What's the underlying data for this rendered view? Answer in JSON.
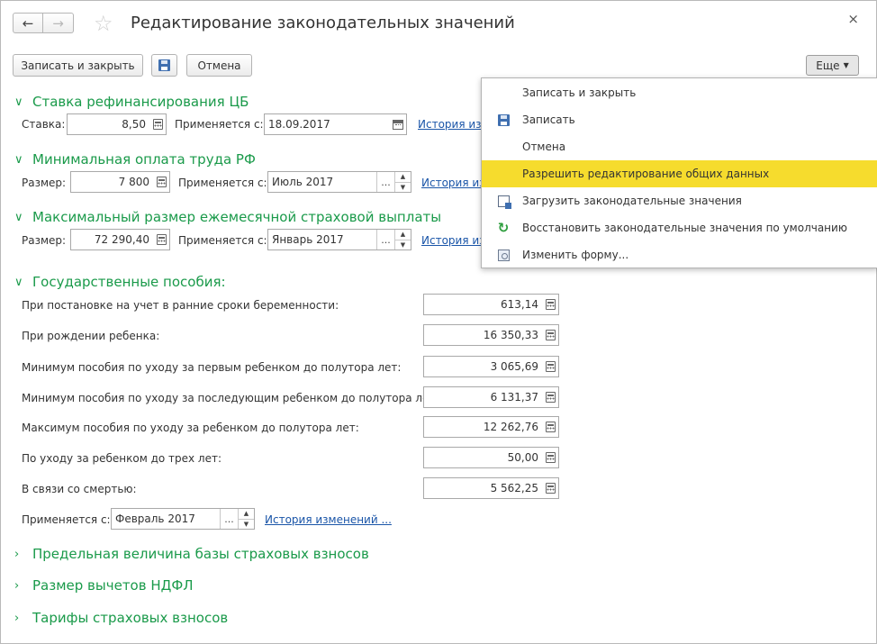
{
  "window": {
    "title": "Редактирование законодательных значений",
    "close_glyph": "×"
  },
  "toolbar": {
    "save_close_label": "Записать и закрыть",
    "cancel_label": "Отмена",
    "more_label": "Еще"
  },
  "more_menu": {
    "items": [
      {
        "label": "Записать и закрыть",
        "icon": ""
      },
      {
        "label": "Записать",
        "icon": "save-icon"
      },
      {
        "label": "Отмена",
        "icon": ""
      },
      {
        "label": "Разрешить редактирование общих данных",
        "icon": "",
        "highlighted": true
      },
      {
        "label": "Загрузить законодательные значения",
        "icon": "load-icon"
      },
      {
        "label": "Восстановить законодательные значения по умолчанию",
        "icon": "restore-icon"
      },
      {
        "label": "Изменить форму...",
        "icon": "change-form-icon"
      }
    ]
  },
  "refinancing": {
    "title": "Ставка рефинансирования ЦБ",
    "rate_label": "Ставка:",
    "rate_value": "8,50",
    "applies_label": "Применяется с:",
    "applies_value": "18.09.2017",
    "history_link": "История изм"
  },
  "min_wage": {
    "title": "Минимальная оплата труда РФ",
    "size_label": "Размер:",
    "size_value": "7 800",
    "applies_label": "Применяется с:",
    "applies_value": "Июль 2017",
    "history_link": "История из"
  },
  "max_insurance": {
    "title": "Максимальный размер ежемесячной страховой выплаты",
    "size_label": "Размер:",
    "size_value": "72 290,40",
    "applies_label": "Применяется с:",
    "applies_value": "Январь 2017",
    "history_link": "История из"
  },
  "benefits": {
    "title": "Государственные пособия:",
    "rows": [
      {
        "label": "При постановке на учет в ранние сроки беременности:",
        "value": "613,14"
      },
      {
        "label": "При рождении ребенка:",
        "value": "16 350,33"
      },
      {
        "label": "Минимум пособия по уходу за первым ребенком до полутора лет:",
        "value": "3 065,69"
      },
      {
        "label": "Минимум пособия по уходу за последующим ребенком до полутора лет:",
        "value": "6 131,37"
      },
      {
        "label": "Максимум пособия по уходу за ребенком до полутора лет:",
        "value": "12 262,76"
      },
      {
        "label": "По уходу за ребенком до трех лет:",
        "value": "50,00"
      },
      {
        "label": "В связи со смертью:",
        "value": "5 562,25"
      }
    ],
    "applies_label": "Применяется с:",
    "applies_value": "Февраль 2017",
    "history_link": "История изменений ..."
  },
  "collapsed_sections": [
    {
      "title": "Предельная величина базы страховых взносов"
    },
    {
      "title": "Размер вычетов НДФЛ"
    },
    {
      "title": "Тарифы страховых взносов"
    }
  ],
  "colors": {
    "accent_green": "#1a9a4a",
    "highlight_yellow": "#f6dc2d",
    "link_blue": "#1a55a8"
  }
}
